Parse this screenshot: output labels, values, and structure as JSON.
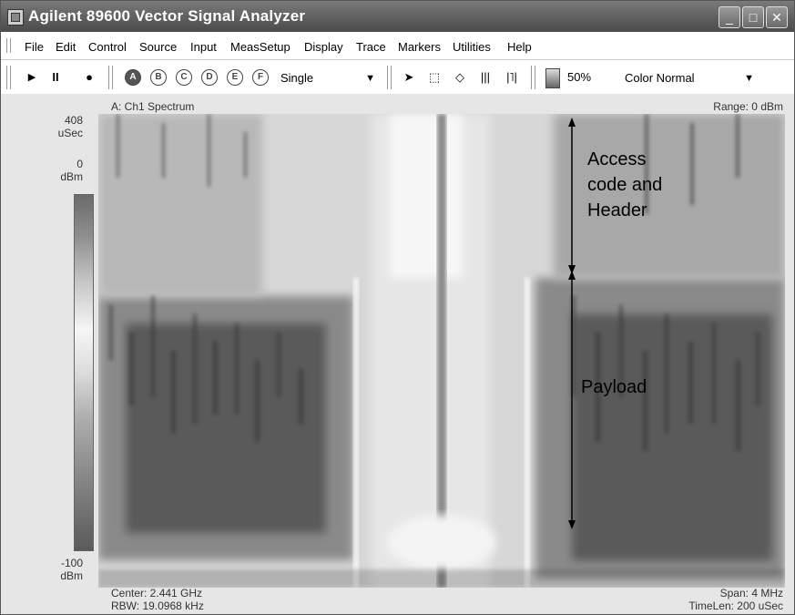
{
  "window": {
    "title": "Agilent 89600 Vector Signal Analyzer"
  },
  "titlebar_buttons": {
    "minimize": "_",
    "maximize": "□",
    "close": "✕"
  },
  "menu": [
    "File",
    "Edit",
    "Control",
    "Source",
    "Input",
    "MeasSetup",
    "Display",
    "Trace",
    "Markers",
    "Utilities",
    "Help"
  ],
  "toolbar": {
    "play": "▶",
    "pause": "II",
    "record": "●",
    "trace_buttons": [
      "A",
      "B",
      "C",
      "D",
      "E",
      "F"
    ],
    "mode_select": "Single",
    "tools": {
      "pointer": "➤",
      "marquee": "⬚",
      "diamond": "◇",
      "bars": "|||",
      "marker": "|˥|"
    },
    "zoom": "50%",
    "color_select": "Color Normal"
  },
  "plot": {
    "trace_title": "A: Ch1 Spectrum",
    "range": "Range: 0 dBm",
    "top_time": "408\nuSec",
    "scale_top": "0\ndBm",
    "scale_bottom": "-100\ndBm",
    "center": "Center: 2.441 GHz",
    "rbw": "RBW: 19.0968 kHz",
    "span": "Span: 4 MHz",
    "timelen": "TimeLen: 200 uSec"
  },
  "annotations": {
    "access": "Access\ncode and\nHeader",
    "payload": "Payload"
  },
  "colors": {
    "titlebar": "#5a5a5a",
    "background": "#d9d9d9"
  }
}
